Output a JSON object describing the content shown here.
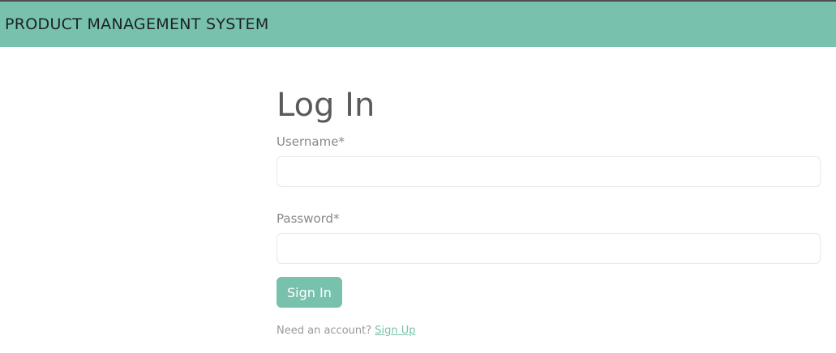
{
  "navbar": {
    "brand": "PRODUCT MANAGEMENT SYSTEM",
    "background": "#78c2ad"
  },
  "form": {
    "title": "Log In",
    "username_label": "Username*",
    "username_value": "",
    "password_label": "Password*",
    "password_value": "",
    "submit_label": "Sign In",
    "signup_prompt": "Need an account?",
    "signup_link": "Sign Up"
  },
  "colors": {
    "accent": "#78c2ad"
  }
}
